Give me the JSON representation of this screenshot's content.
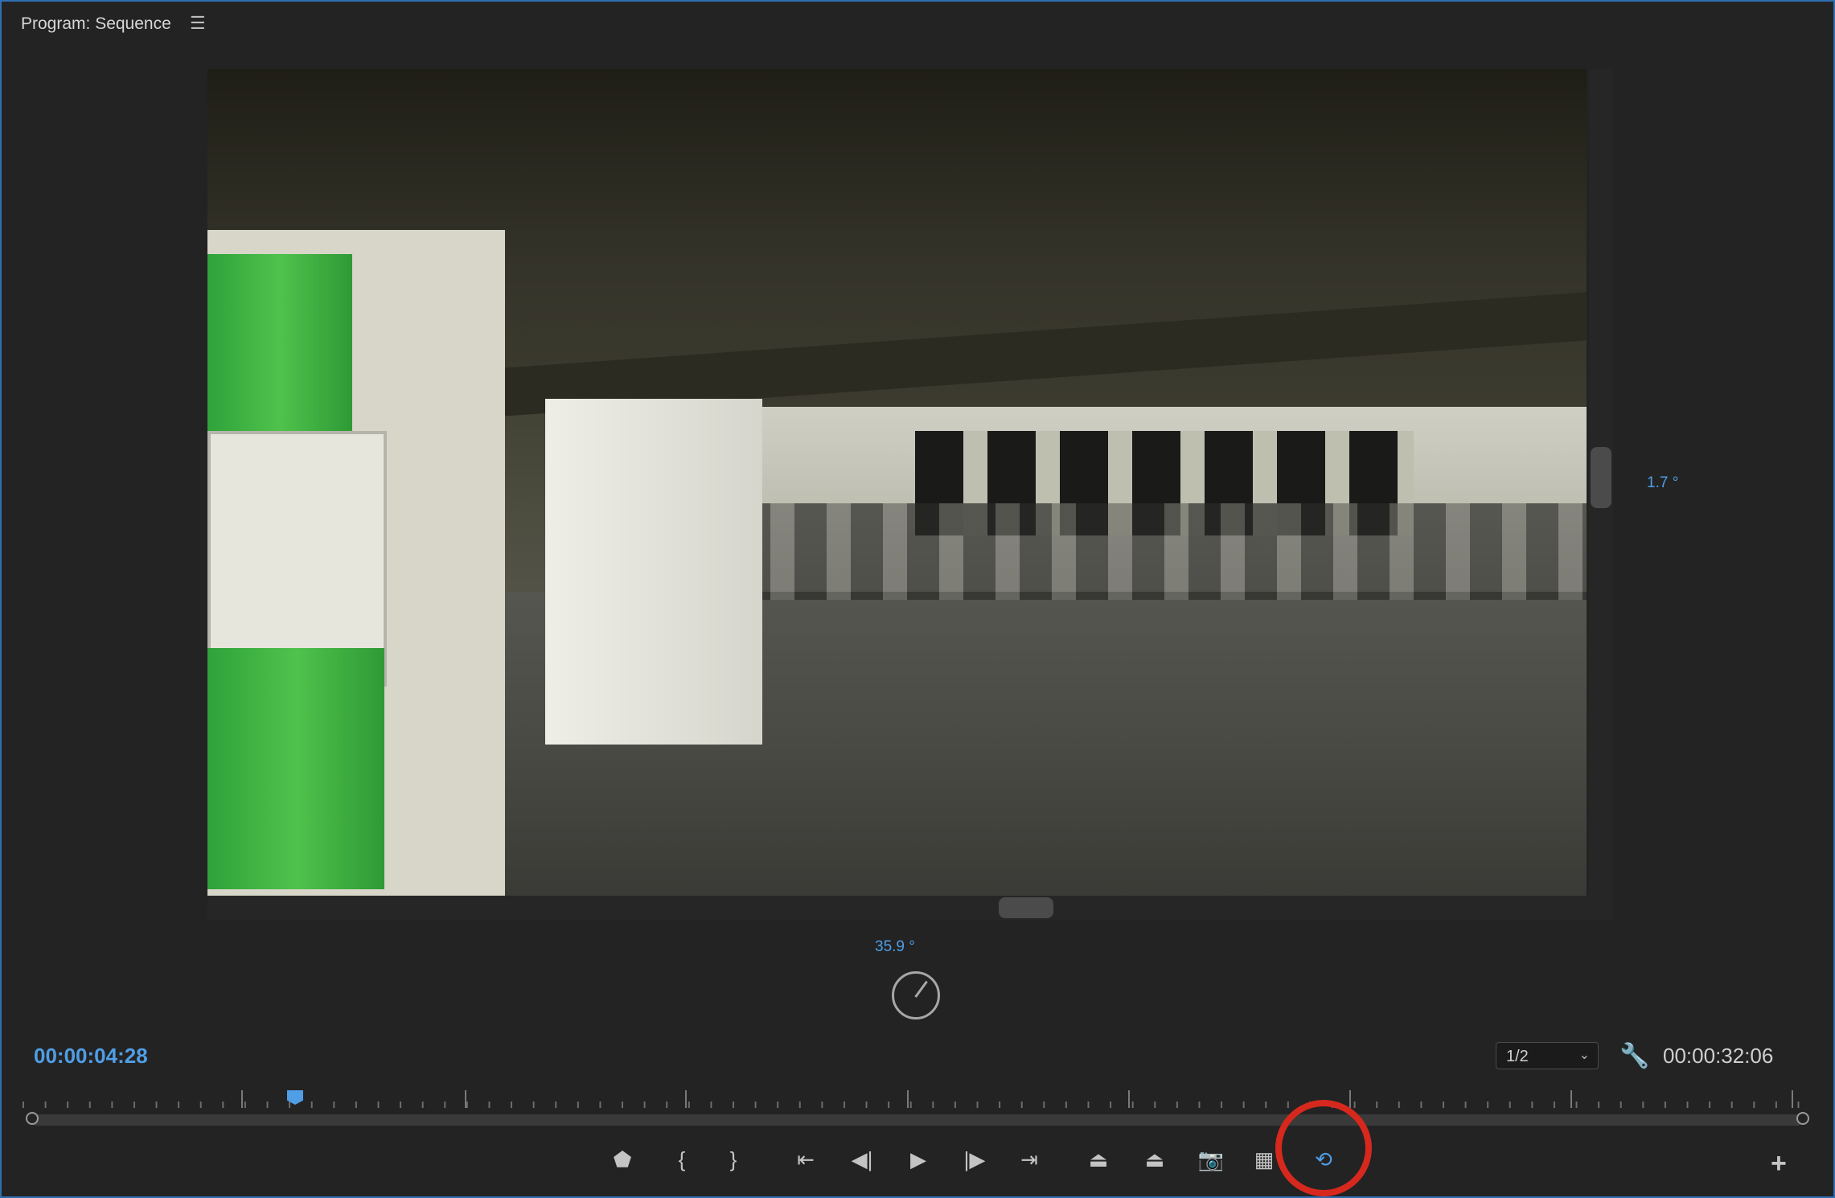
{
  "panel": {
    "title": "Program: Sequence",
    "menu_icon": "hamburger-menu-icon"
  },
  "viewer": {
    "vertical_angle": "1.7 °",
    "horizontal_angle": "35.9 °"
  },
  "timecode": {
    "current": "00:00:04:28",
    "duration": "00:00:32:06"
  },
  "playback_resolution": {
    "selected": "1/2"
  },
  "transport": {
    "buttons": [
      {
        "name": "add-marker-button",
        "icon": "marker-icon",
        "glyph": "⬟"
      },
      {
        "name": "mark-in-button",
        "icon": "mark-in-icon",
        "glyph": "{"
      },
      {
        "name": "mark-out-button",
        "icon": "mark-out-icon",
        "glyph": "}"
      },
      {
        "name": "go-to-in-button",
        "icon": "go-to-in-icon",
        "glyph": "⇤"
      },
      {
        "name": "step-back-button",
        "icon": "step-back-icon",
        "glyph": "◀|"
      },
      {
        "name": "play-button",
        "icon": "play-icon",
        "glyph": "▶"
      },
      {
        "name": "step-forward-button",
        "icon": "step-forward-icon",
        "glyph": "|▶"
      },
      {
        "name": "go-to-out-button",
        "icon": "go-to-out-icon",
        "glyph": "⇥"
      },
      {
        "name": "lift-button",
        "icon": "lift-icon",
        "glyph": "⏏"
      },
      {
        "name": "extract-button",
        "icon": "extract-icon",
        "glyph": "⏏"
      },
      {
        "name": "export-frame-button",
        "icon": "camera-icon",
        "glyph": "📷"
      },
      {
        "name": "comparison-view-button",
        "icon": "comparison-view-icon",
        "glyph": "▦"
      },
      {
        "name": "toggle-vr-video-button",
        "icon": "vr-video-icon",
        "glyph": "⟲"
      }
    ]
  },
  "colors": {
    "accent": "#4f9ee6",
    "highlight_ring": "#d7281e",
    "panel_border": "#2f6fb3"
  }
}
